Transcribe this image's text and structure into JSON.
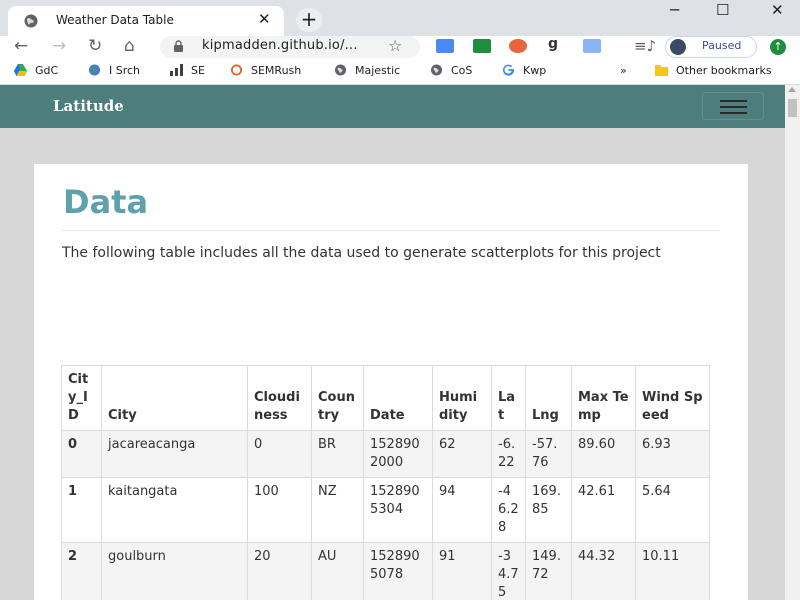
{
  "browser": {
    "tab_title": "Weather Data Table",
    "url": "kipmadden.github.io/...",
    "profile_status": "Paused",
    "bookmarks": [
      {
        "label": "GdC",
        "icon": "drive-icon"
      },
      {
        "label": "I Srch",
        "icon": "globe-icon"
      },
      {
        "label": "SE",
        "icon": "bar-chart-icon"
      },
      {
        "label": "SEMRush",
        "icon": "semrush-icon"
      },
      {
        "label": "Majestic",
        "icon": "globe-icon"
      },
      {
        "label": "CoS",
        "icon": "globe-icon"
      },
      {
        "label": "Kwp",
        "icon": "google-icon"
      }
    ],
    "more_bookmarks": "»",
    "other_bookmarks": "Other bookmarks"
  },
  "site": {
    "brand": "Latitude"
  },
  "page": {
    "heading": "Data",
    "intro": "The following table includes all the data used to generate scatterplots for this project"
  },
  "table": {
    "headers": [
      "City_ID",
      "City",
      "Cloudiness",
      "Country",
      "Date",
      "Humidity",
      "Lat",
      "Lng",
      "Max Temp",
      "Wind Speed"
    ],
    "rows": [
      [
        "0",
        "jacareacanga",
        "0",
        "BR",
        "1528902000",
        "62",
        "-6.22",
        "-57.76",
        "89.60",
        "6.93"
      ],
      [
        "1",
        "kaitangata",
        "100",
        "NZ",
        "1528905304",
        "94",
        "-46.28",
        "169.85",
        "42.61",
        "5.64"
      ],
      [
        "2",
        "goulburn",
        "20",
        "AU",
        "1528905078",
        "91",
        "-34.75",
        "149.72",
        "44.32",
        "10.11"
      ]
    ]
  },
  "colors": {
    "navbar": "#4e7d7d",
    "heading": "#5fa0ad"
  }
}
